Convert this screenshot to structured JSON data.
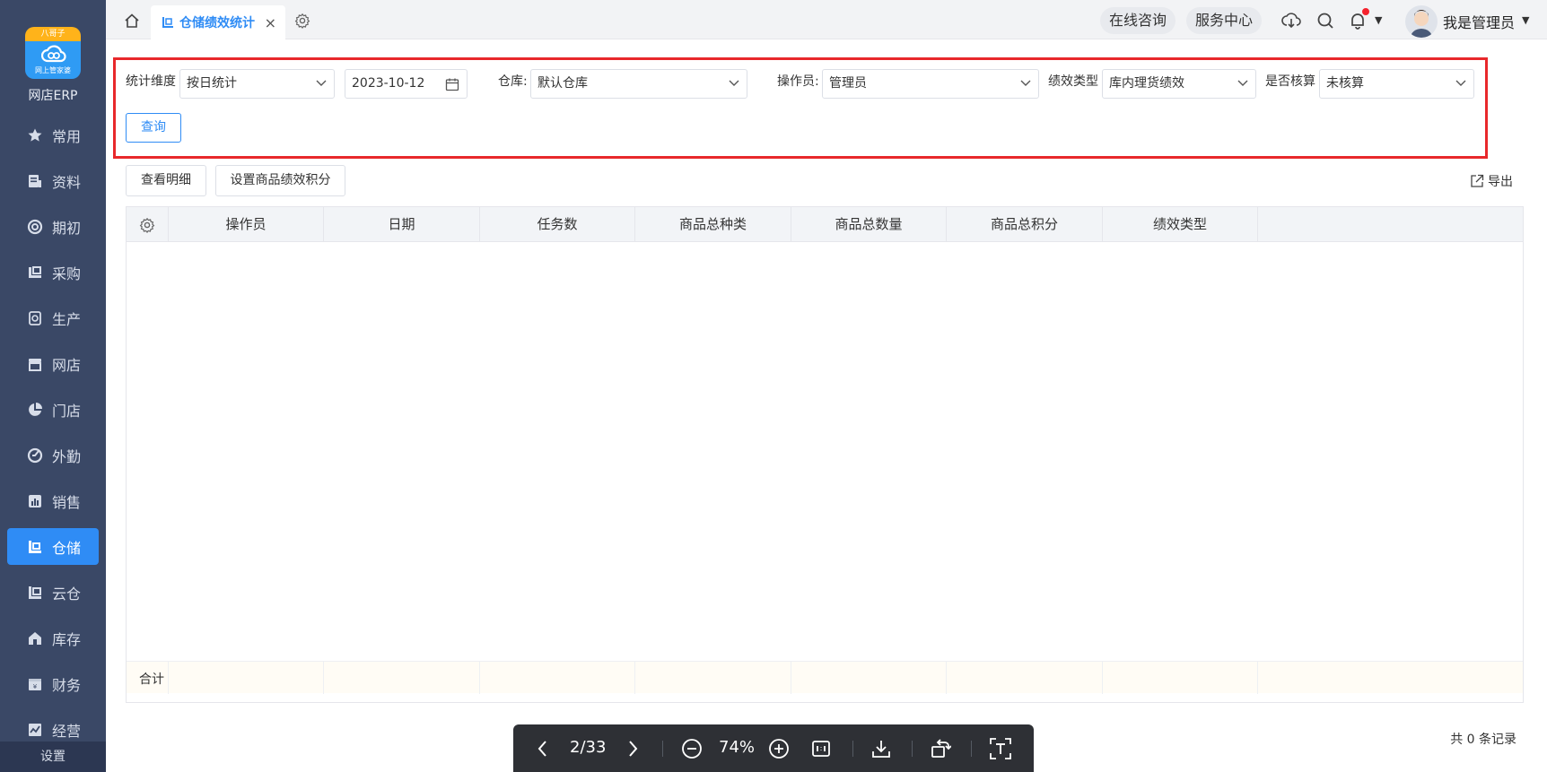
{
  "sidebar": {
    "logo_badge": "八哥子",
    "logo_sub": "网上管家婆",
    "brand": "网店ERP",
    "items": [
      {
        "label": "常用",
        "icon": "star-icon"
      },
      {
        "label": "资料",
        "icon": "doc-icon"
      },
      {
        "label": "期初",
        "icon": "target-icon"
      },
      {
        "label": "采购",
        "icon": "purchase-icon"
      },
      {
        "label": "生产",
        "icon": "production-icon"
      },
      {
        "label": "网店",
        "icon": "store-icon"
      },
      {
        "label": "门店",
        "icon": "pie-icon"
      },
      {
        "label": "外勤",
        "icon": "fieldwork-icon"
      },
      {
        "label": "销售",
        "icon": "bar-chart-icon"
      },
      {
        "label": "仓储",
        "icon": "warehouse-icon",
        "active": true
      },
      {
        "label": "云仓",
        "icon": "cloud-warehouse-icon"
      },
      {
        "label": "库存",
        "icon": "house-icon"
      },
      {
        "label": "财务",
        "icon": "finance-icon"
      },
      {
        "label": "经营",
        "icon": "business-icon"
      }
    ],
    "settings": "设置"
  },
  "topbar": {
    "tab_label": "仓储绩效统计",
    "tab_close": "×",
    "online_consult": "在线咨询",
    "service_center": "服务中心",
    "user_name": "我是管理员"
  },
  "filters": {
    "dimension_label": "统计维度",
    "dimension_value": "按日统计",
    "date_value": "2023-10-12",
    "warehouse_label": "仓库:",
    "warehouse_value": "默认仓库",
    "operator_label": "操作员:",
    "operator_value": "管理员",
    "perf_type_label": "绩效类型",
    "perf_type_value": "库内理货绩效",
    "accounted_label": "是否核算",
    "accounted_value": "未核算",
    "query_button": "查询"
  },
  "actions": {
    "view_detail": "查看明细",
    "set_points": "设置商品绩效积分",
    "export": "导出"
  },
  "table": {
    "columns": [
      "操作员",
      "日期",
      "任务数",
      "商品总种类",
      "商品总数量",
      "商品总积分",
      "绩效类型"
    ],
    "rows": [],
    "footer_label": "合计",
    "records_text": "共 0 条记录"
  },
  "viewer": {
    "page": "2/33",
    "zoom": "74%"
  },
  "colors": {
    "sidebar_bg": "#3a4866",
    "accent": "#2f8cf5",
    "highlight_border": "#e8282b"
  }
}
